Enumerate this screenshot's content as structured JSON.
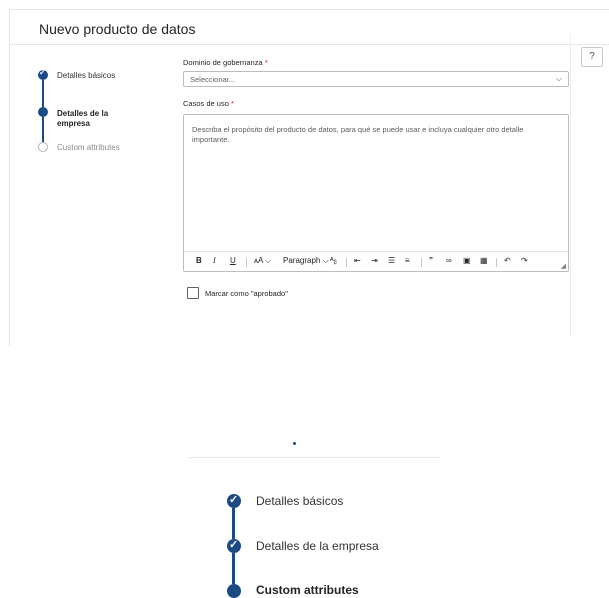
{
  "panel": {
    "title": "Nuevo producto de datos",
    "help_icon": "question-circle-icon"
  },
  "steps": [
    {
      "label": "Detalles básicos",
      "state": "done"
    },
    {
      "label": "Detalles de la empresa",
      "state": "current"
    },
    {
      "label": "Custom attributes",
      "state": "pending"
    }
  ],
  "form": {
    "governance": {
      "label": "Dominio de gobernanza",
      "required_mark": "*",
      "value": "Seleccionar..."
    },
    "use_cases": {
      "label": "Casos de uso",
      "required_mark": "*",
      "placeholder": "Describa el propósito del producto de datos, para qué se puede usar e incluya cualquier otro detalle importante."
    },
    "toolbar": {
      "bold": "B",
      "italic": "I",
      "underline": "U",
      "font_size": "ᴀA ⌵",
      "paragraph": "Paragraph ⌵",
      "highlight": "ᴬᵦ",
      "undo": "↶",
      "redo": "↷"
    },
    "approved_checkbox": {
      "label": "Marcar como \"aprobado\"",
      "checked": false
    }
  },
  "zoom": {
    "steps": [
      {
        "label": "Detalles básicos",
        "state": "done"
      },
      {
        "label": "Detalles de la empresa",
        "state": "done"
      },
      {
        "label": "Custom attributes",
        "state": "current"
      }
    ]
  },
  "colors": {
    "accent": "#1b4a85",
    "required": "#c50f1f"
  }
}
